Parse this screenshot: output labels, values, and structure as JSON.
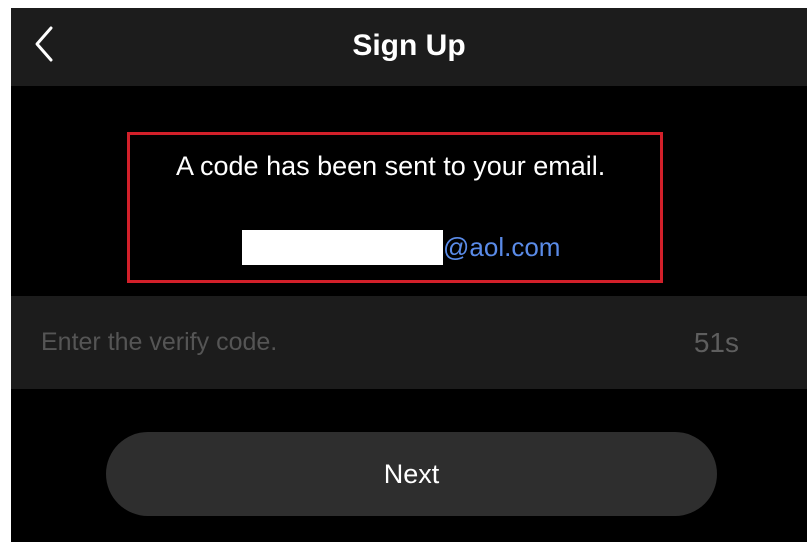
{
  "nav": {
    "title": "Sign Up",
    "back_icon": "chevron-left-icon"
  },
  "notice": {
    "message": "A code has been sent to your email.",
    "email_domain": "@aol.com",
    "colors": {
      "border": "#d3202a",
      "email_link": "#5a8be8"
    }
  },
  "verify": {
    "placeholder": "Enter the verify code.",
    "value": "",
    "countdown": "51s"
  },
  "actions": {
    "next_label": "Next"
  }
}
